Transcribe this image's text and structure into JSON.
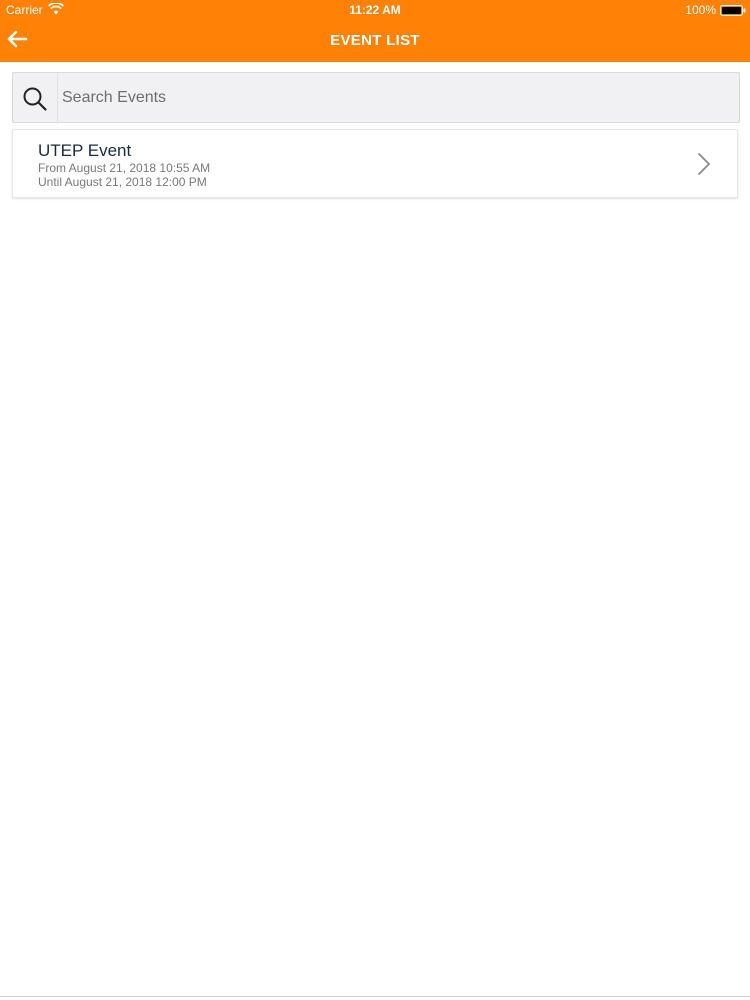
{
  "status_bar": {
    "carrier": "Carrier",
    "time": "11:22 AM",
    "battery": "100%"
  },
  "header": {
    "title": "EVENT LIST",
    "accent_color": "#ff8207",
    "back_icon": "arrow-left-icon"
  },
  "search": {
    "placeholder": "Search Events",
    "value": "",
    "icon": "search-icon"
  },
  "events": [
    {
      "title": "UTEP Event",
      "from": "From August 21, 2018 10:55 AM",
      "until": "Until August 21, 2018 12:00 PM",
      "icon": "chevron-right-icon"
    }
  ]
}
